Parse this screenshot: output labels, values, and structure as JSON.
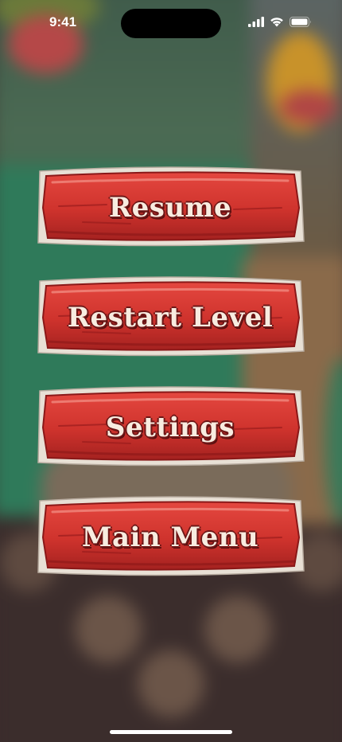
{
  "status_bar": {
    "time": "9:41",
    "icons": [
      "signal-icon",
      "wifi-icon",
      "battery-icon"
    ]
  },
  "pause_menu": {
    "buttons": [
      {
        "label": "Resume"
      },
      {
        "label": "Restart Level"
      },
      {
        "label": "Settings"
      },
      {
        "label": "Main Menu"
      }
    ]
  },
  "colors": {
    "plank_red": "#d63a33",
    "plank_dark": "#9e1e1e",
    "plank_border": "#e6ddd2",
    "text": "#f8ece0",
    "text_outline": "#6e1717"
  }
}
